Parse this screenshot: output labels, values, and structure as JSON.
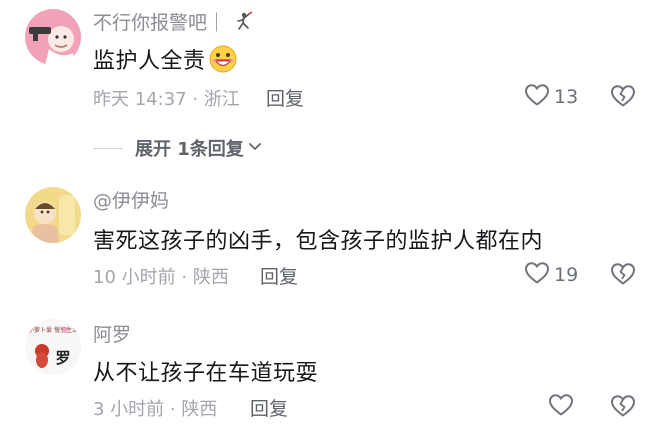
{
  "comments": [
    {
      "username": "不行你报警吧｜",
      "text": "监护人全责",
      "time": "昨天 14:37",
      "location": "浙江",
      "reply_label": "回复",
      "likes": "13"
    },
    {
      "username": "@伊伊妈",
      "text": "害死这孩子的凶手，包含孩子的监护人都在内",
      "time": "10 小时前",
      "location": "陕西",
      "reply_label": "回复",
      "likes": "19"
    },
    {
      "username": "阿罗",
      "text": "从不让孩子在车道玩耍",
      "time": "3 小时前",
      "location": "陕西",
      "reply_label": "回复",
      "likes": ""
    }
  ],
  "expand_replies": {
    "label": "展开 1 条回复",
    "prefix": "展开",
    "count": "1",
    "suffix": "条回复"
  },
  "separator": "·",
  "avatar_badge_text": "罗",
  "avatar_caption": "小萝卜爱 慢享生活",
  "colors": {
    "username": "#8a8d94",
    "content": "#16181c",
    "meta": "#a3a6ac",
    "reply": "#5f636b",
    "icon": "#70747b",
    "avatar1_bg": "#f2a2b8",
    "avatar2_bg": "#f3d98a"
  },
  "icons": {
    "like": "heart-outline-icon",
    "dislike": "broken-heart-icon",
    "expand": "chevron-down-icon",
    "emoji": "grinning-emoji-icon",
    "name_badge": "fencer-icon"
  }
}
